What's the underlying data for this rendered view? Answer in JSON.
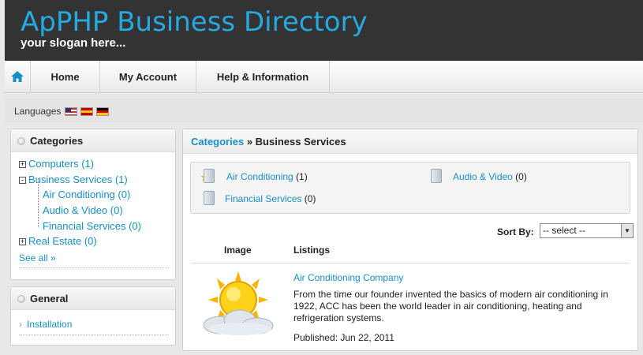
{
  "header": {
    "title": "ApPHP Business Directory",
    "slogan": "your slogan here..."
  },
  "nav": {
    "items": [
      "Home",
      "My Account",
      "Help & Information"
    ]
  },
  "languages": {
    "label": "Languages",
    "flags": [
      "us-flag-icon",
      "es-flag-icon",
      "de-flag-icon"
    ]
  },
  "categories": {
    "title": "Categories",
    "tree": [
      {
        "toggle": "+",
        "label": "Computers (1)"
      },
      {
        "toggle": "-",
        "label": "Business Services (1)"
      },
      {
        "toggle": "",
        "label": "Air Conditioning (0)"
      },
      {
        "toggle": "",
        "label": "Audio & Video (0)"
      },
      {
        "toggle": "",
        "label": "Financial Services (0)"
      },
      {
        "toggle": "+",
        "label": "Real Estate (0)"
      }
    ],
    "see_all": "See all »"
  },
  "general": {
    "title": "General",
    "items": [
      "Installation"
    ]
  },
  "main": {
    "breadcrumb_link": "Categories",
    "breadcrumb_sep": " » ",
    "breadcrumb_current": "Business Services",
    "subcategories": [
      {
        "name": "Air Conditioning",
        "count": " (1)"
      },
      {
        "name": "Audio & Video",
        "count": " (0)"
      },
      {
        "name": "Financial Services",
        "count": " (0)"
      }
    ],
    "sort_label": "Sort By:",
    "sort_value": "-- select --",
    "col_image": "Image",
    "col_listings": "Listings",
    "listing": {
      "name": "Air Conditioning Company",
      "description": "From the time our founder invented the basics of modern air conditioning in 1922, ACC has been the world leader in air conditioning, heating and refrigeration systems.",
      "published": "Published: Jun 22, 2011"
    }
  },
  "colors": {
    "header_bg": "#333333",
    "title": "#26a9e0",
    "link": "#1a8fc4"
  }
}
